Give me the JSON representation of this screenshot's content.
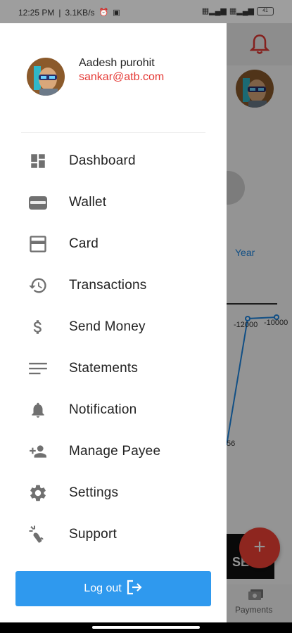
{
  "status_bar": {
    "time": "12:25 PM",
    "speed": "3.1KB/s",
    "battery": "41"
  },
  "profile": {
    "name": "Aadesh purohit",
    "email": "sankar@atb.com",
    "avatar_icon": "user-avatar-icon"
  },
  "menu": [
    {
      "label": "Dashboard",
      "icon": "dashboard-icon"
    },
    {
      "label": "Wallet",
      "icon": "wallet-icon"
    },
    {
      "label": "Card",
      "icon": "credit-card-icon"
    },
    {
      "label": "Transactions",
      "icon": "history-icon"
    },
    {
      "label": "Send Money",
      "icon": "dollar-icon"
    },
    {
      "label": "Statements",
      "icon": "list-icon"
    },
    {
      "label": "Notification",
      "icon": "bell-icon"
    },
    {
      "label": "Manage Payee",
      "icon": "person-add-icon"
    },
    {
      "label": "Settings",
      "icon": "gear-icon"
    },
    {
      "label": "Support",
      "icon": "support-icon"
    }
  ],
  "logout": {
    "label": "Log out",
    "icon": "logout-icon"
  },
  "background": {
    "year_label": "Year",
    "chart_label_1": "-12000",
    "chart_label_2": "-10000",
    "chart_label_3": "56",
    "send_button_label": "SE",
    "fab_label": "+",
    "payments_label": "Payments"
  },
  "colors": {
    "accent": "#2f99ee",
    "email": "#e53935",
    "fab": "#f44336",
    "icon": "#707070"
  }
}
